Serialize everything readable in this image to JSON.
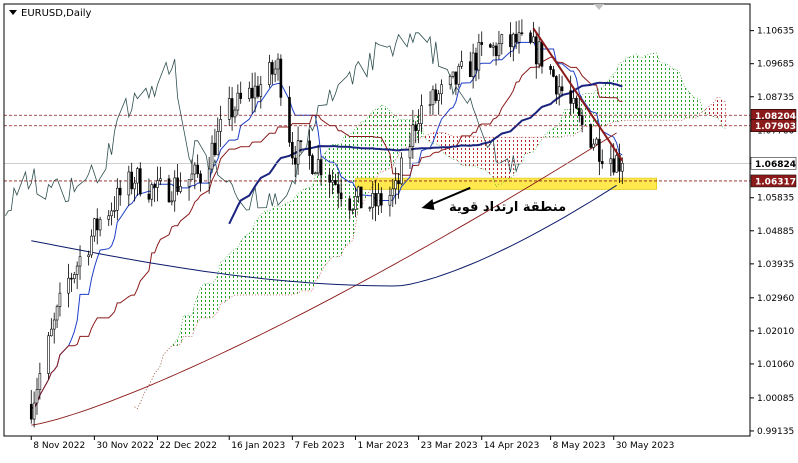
{
  "window": {
    "title": "EURUSD,Daily"
  },
  "annotation": {
    "text": "منطقة ارتداد قوية"
  },
  "colors": {
    "candles": "#000000",
    "frame": "#000000",
    "ma_fast": "#1a237e",
    "ma_slow": "#0d1b6b",
    "ma_long": "#8b1a1a",
    "tenkan": "#1e3fc8",
    "kijun": "#8b1a1a",
    "chikou": "#2f4f4f",
    "cloud_bull": "#1f9d1f",
    "cloud_bear": "#b22222",
    "support_zone": "#ffe94d",
    "trendline": "#8b1a1a",
    "level_line": "#8b1a1a",
    "price_tag": "#8b1a1a",
    "current_tag": "#ffffff"
  },
  "chart_data": {
    "type": "candlestick",
    "symbol": "EURUSD",
    "timeframe": "Daily",
    "ylim": [
      0.9899,
      1.114
    ],
    "y_ticks": [
      "1.10635",
      "1.09685",
      "1.08735",
      "1.07760",
      "1.06824",
      "1.05835",
      "1.04885",
      "1.03935",
      "1.02960",
      "1.02010",
      "1.01060",
      "1.00085",
      "0.99135"
    ],
    "x_ticks": [
      "8 Nov 2022",
      "30 Nov 2022",
      "22 Dec 2022",
      "16 Jan 2023",
      "7 Feb 2023",
      "1 Mar 2023",
      "23 Mar 2023",
      "14 Apr 2023",
      "8 May 2023",
      "30 May 2023"
    ],
    "levels": [
      {
        "label": "1.08204",
        "value": 1.08204
      },
      {
        "label": "1.07903",
        "value": 1.07903
      },
      {
        "label": "1.06317",
        "value": 1.06317
      }
    ],
    "current_price": {
      "label": "1.06824",
      "value": 1.06824
    },
    "support_zone": {
      "low": 1.0607,
      "high": 1.064
    },
    "anchors": [
      {
        "date": "8 Nov 2022",
        "close": 0.999
      },
      {
        "date": "20 Nov 2022",
        "close": 1.033
      },
      {
        "date": "2 Dec 2022",
        "close": 1.052
      },
      {
        "date": "14 Dec 2022",
        "close": 1.064
      },
      {
        "date": "22 Dec 2022",
        "close": 1.06
      },
      {
        "date": "6 Jan 2023",
        "close": 1.065
      },
      {
        "date": "16 Jan 2023",
        "close": 1.083
      },
      {
        "date": "26 Jan 2023",
        "close": 1.09
      },
      {
        "date": "2 Feb 2023",
        "close": 1.096
      },
      {
        "date": "7 Feb 2023",
        "close": 1.072
      },
      {
        "date": "17 Feb 2023",
        "close": 1.068
      },
      {
        "date": "27 Feb 2023",
        "close": 1.058
      },
      {
        "date": "7 Mar 2023",
        "close": 1.056
      },
      {
        "date": "15 Mar 2023",
        "close": 1.06
      },
      {
        "date": "23 Mar 2023",
        "close": 1.083
      },
      {
        "date": "3 Apr 2023",
        "close": 1.09
      },
      {
        "date": "14 Apr 2023",
        "close": 1.1
      },
      {
        "date": "26 Apr 2023",
        "close": 1.103
      },
      {
        "date": "4 May 2023",
        "close": 1.1
      },
      {
        "date": "10 May 2023",
        "close": 1.092
      },
      {
        "date": "18 May 2023",
        "close": 1.08
      },
      {
        "date": "26 May 2023",
        "close": 1.072
      },
      {
        "date": "2 Jun 2023",
        "close": 1.0682
      }
    ],
    "trendline": [
      {
        "date": "2 May 2023",
        "value": 1.107
      },
      {
        "date": "2 Jun 2023",
        "value": 1.069
      }
    ]
  }
}
